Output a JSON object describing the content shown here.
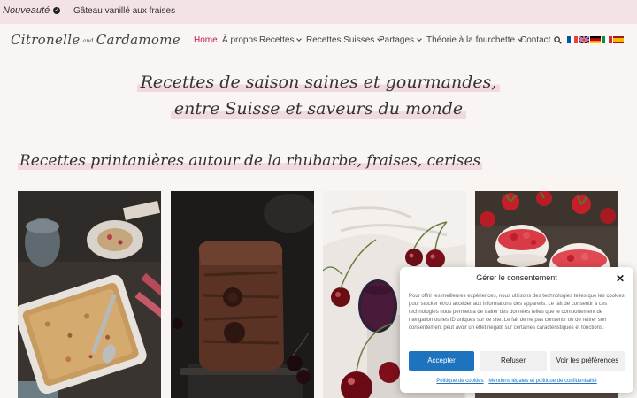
{
  "topbar": {
    "badge": "Nouveauté",
    "promo": "Gâteau vanillé aux fraises"
  },
  "logo": {
    "part1": "Citronelle",
    "amp": "and",
    "part2": "Cardamome"
  },
  "nav": {
    "items": [
      {
        "label": "Home"
      },
      {
        "label": "À propos"
      },
      {
        "label": "Recettes"
      },
      {
        "label": "Recettes Suisses"
      },
      {
        "label": "Partages"
      },
      {
        "label": "Théorie à la fourchette"
      },
      {
        "label": "Contact"
      }
    ],
    "active_color": "#c2185b"
  },
  "hero": {
    "line1": "Recettes de saison saines et gourmandes,",
    "line2": "entre Suisse et saveurs du monde"
  },
  "section": {
    "title": "Recettes printanières autour de la rhubarbe, fraises, cerises"
  },
  "cookie": {
    "title": "Gérer le consentement",
    "text": "Pour offrir les meilleures expériences, nous utilisons des technologies telles que les cookies pour stocker et/ou accéder aux informations des appareils. Le fait de consentir à ces technologies nous permettra de traiter des données telles que le comportement de navigation ou les ID uniques sur ce site. Le fait de ne pas consentir ou de retirer son consentement peut avoir un effet négatif sur certaines caractéristiques et fonctions.",
    "accept": "Accepter",
    "refuse": "Refuser",
    "prefs": "Voir les préférences",
    "link1": "Politique de cookies",
    "link2": "Mentions légales et politique de confidentialité"
  }
}
